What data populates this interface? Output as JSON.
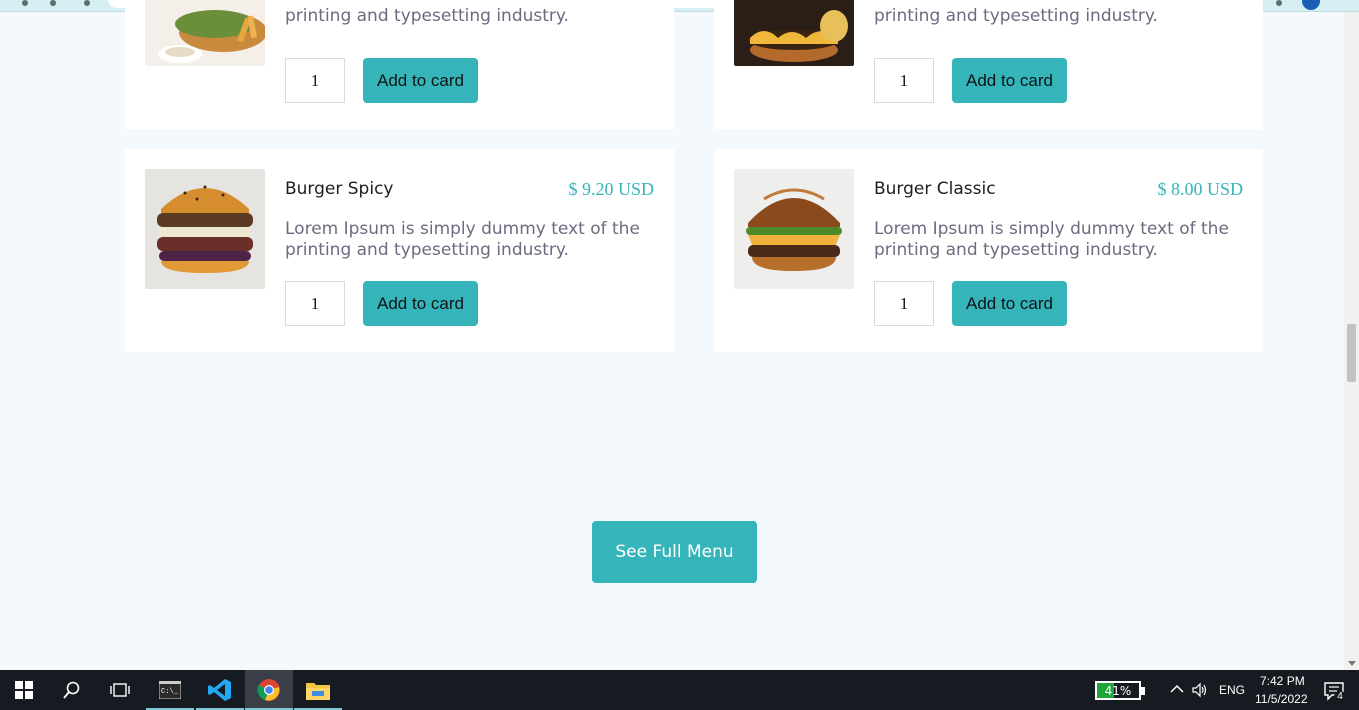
{
  "menu": {
    "top_row": [
      {
        "desc_tail": "printing and typesetting industry.",
        "qty": "1",
        "button": "Add to card"
      },
      {
        "desc_tail": "printing and typesetting industry.",
        "qty": "1",
        "button": "Add to card"
      }
    ],
    "items": [
      {
        "name": "Burger Spicy",
        "price": "$ 9.20 USD",
        "desc": "Lorem Ipsum is simply dummy text of the printing and typesetting industry.",
        "qty": "1",
        "button": "Add to card"
      },
      {
        "name": "Burger Classic",
        "price": "$ 8.00 USD",
        "desc": "Lorem Ipsum is simply dummy text of the printing and typesetting industry.",
        "qty": "1",
        "button": "Add to card"
      }
    ],
    "see_full_menu": "See Full Menu"
  },
  "taskbar": {
    "battery_percent": "41%",
    "battery_level": 0.41,
    "language": "ENG",
    "time": "7:42 PM",
    "date": "11/5/2022",
    "notification_count": "4"
  },
  "colors": {
    "accent": "#35b5b9",
    "page_bg": "#f3f9fc",
    "taskbar_bg": "#161a21"
  }
}
